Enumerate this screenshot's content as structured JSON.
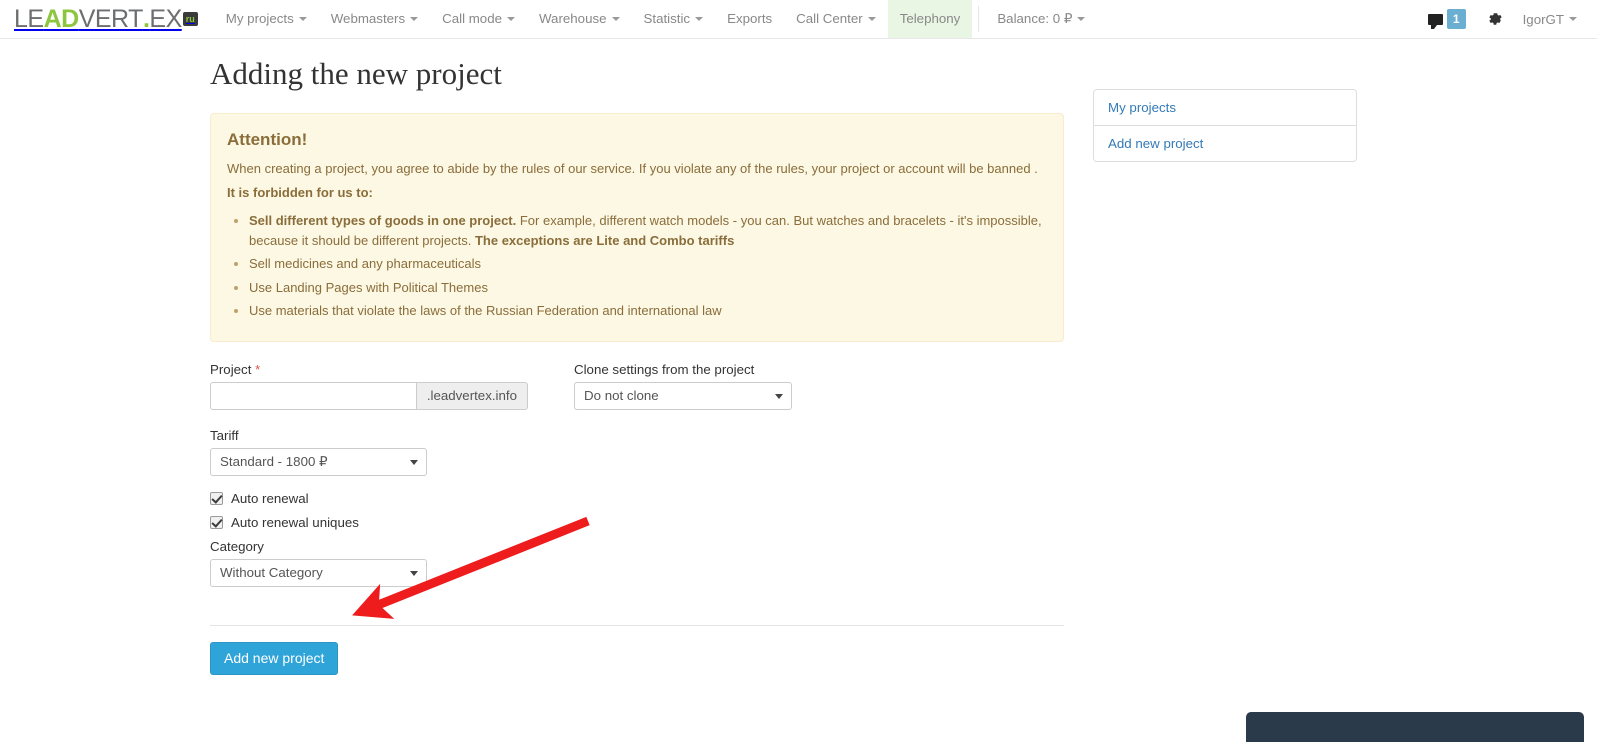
{
  "navbar": {
    "brand": {
      "part1": "LE",
      "part2": "AD",
      "part3": "VERT",
      "dot": ".",
      "part4": "EX",
      "tld": "ru"
    },
    "menu": [
      {
        "label": "My projects",
        "caret": true,
        "highlight": false
      },
      {
        "label": "Webmasters",
        "caret": true,
        "highlight": false
      },
      {
        "label": "Call mode",
        "caret": true,
        "highlight": false
      },
      {
        "label": "Warehouse",
        "caret": true,
        "highlight": false
      },
      {
        "label": "Statistic",
        "caret": true,
        "highlight": false
      },
      {
        "label": "Exports",
        "caret": false,
        "highlight": false
      },
      {
        "label": "Call Center",
        "caret": true,
        "highlight": false
      },
      {
        "label": "Telephony",
        "caret": false,
        "highlight": true
      }
    ],
    "balance": {
      "label": "Balance: 0 ₽",
      "caret": true
    },
    "messages_icon": "chat-icon",
    "messages_count": "1",
    "settings_icon": "gear-icon",
    "user": {
      "name": "IgorGT",
      "caret": true
    }
  },
  "page": {
    "title": "Adding the new project"
  },
  "alert": {
    "heading": "Attention!",
    "intro": "When creating a project, you agree to abide by the rules of our service. If you violate any of the rules, your project or account will be banned .",
    "forbidden_label": "It is forbidden for us to:",
    "rules": [
      {
        "bold_start": "Sell different types of goods in one project.",
        "normal": " For example, different watch models - you can. But watches and bracelets - it's impossible, because it should be different projects. ",
        "bold_end": "The exceptions are Lite and Combo tariffs"
      },
      {
        "bold_start": "",
        "normal": "Sell medicines and any pharmaceuticals",
        "bold_end": ""
      },
      {
        "bold_start": "",
        "normal": "Use Landing Pages with Political Themes",
        "bold_end": ""
      },
      {
        "bold_start": "",
        "normal": "Use materials that violate the laws of the Russian Federation and international law",
        "bold_end": ""
      }
    ]
  },
  "form": {
    "project": {
      "label": "Project",
      "required_mark": "*",
      "value": "",
      "placeholder": "",
      "addon": ".leadvertex.info"
    },
    "clone": {
      "label": "Clone settings from the project",
      "selected": "Do not clone",
      "options": [
        "Do not clone"
      ]
    },
    "tariff": {
      "label": "Tariff",
      "selected": "Standard - 1800 ₽",
      "options": [
        "Standard - 1800 ₽"
      ]
    },
    "auto_renewal": {
      "label": "Auto renewal",
      "checked": true
    },
    "auto_renewal_uniques": {
      "label": "Auto renewal uniques",
      "checked": true
    },
    "category": {
      "label": "Category",
      "selected": "Without Category",
      "options": [
        "Without Category"
      ]
    },
    "submit_label": "Add new project"
  },
  "sidebar": {
    "items": [
      {
        "label": "My projects"
      },
      {
        "label": "Add new project"
      }
    ]
  },
  "annotation": {
    "arrow_color": "#ee1c1c",
    "points_to": "Add new project"
  },
  "colors": {
    "brand_green": "#8cc63e",
    "primary_button": "#2fa4d8",
    "link": "#337ab7",
    "alert_bg": "#fcf8e3",
    "alert_border": "#faebcc",
    "alert_text": "#8a6d3b",
    "badge": "#6aaed1",
    "nav_highlight": "#eaf6e4"
  }
}
